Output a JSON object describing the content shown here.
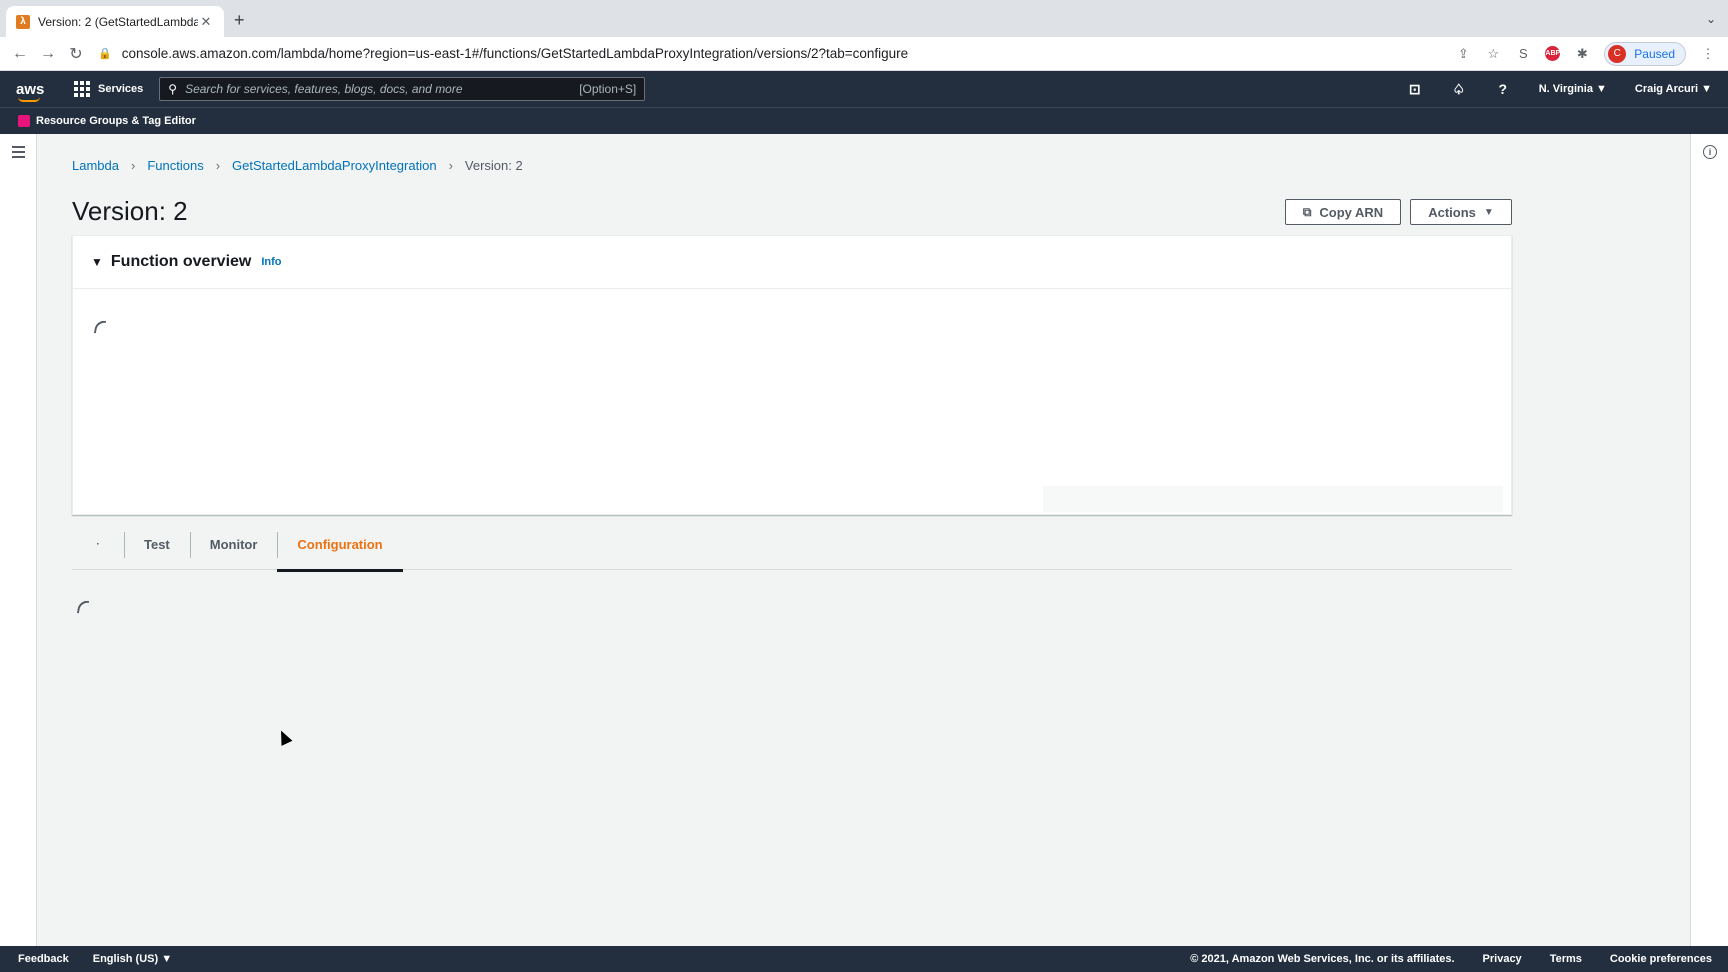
{
  "browser": {
    "tab_title": "Version: 2 (GetStartedLambda",
    "tab_favicon": "aws-lambda-icon",
    "url": "console.aws.amazon.com/lambda/home?region=us-east-1#/functions/GetStartedLambdaProxyIntegration/versions/2?tab=configure",
    "profile_initial": "C",
    "profile_status": "Paused",
    "abp_label": "ABP",
    "ext_s_label": "S"
  },
  "awsnav": {
    "logo": "aws",
    "services_label": "Services",
    "search_placeholder": "Search for services, features, blogs, docs, and more",
    "search_shortcut": "[Option+S]",
    "region": "N. Virginia ▼",
    "user": "Craig Arcuri ▼"
  },
  "favorites": {
    "item": "Resource Groups & Tag Editor"
  },
  "breadcrumb": {
    "items": [
      "Lambda",
      "Functions",
      "GetStartedLambdaProxyIntegration"
    ],
    "current": "Version: 2"
  },
  "page": {
    "title": "Version: 2",
    "copy_arn": "Copy ARN",
    "actions": "Actions"
  },
  "overview": {
    "title": "Function overview",
    "info": "Info"
  },
  "tabs": {
    "items": [
      "Test",
      "Monitor",
      "Configuration"
    ],
    "active": "Configuration"
  },
  "footer": {
    "feedback": "Feedback",
    "language": "English (US) ▼",
    "copyright": "© 2021, Amazon Web Services, Inc. or its affiliates.",
    "privacy": "Privacy",
    "terms": "Terms",
    "cookie": "Cookie preferences"
  },
  "colors": {
    "nav_bg": "#232f3e",
    "link": "#0073bb",
    "active_tab": "#ec7211"
  }
}
